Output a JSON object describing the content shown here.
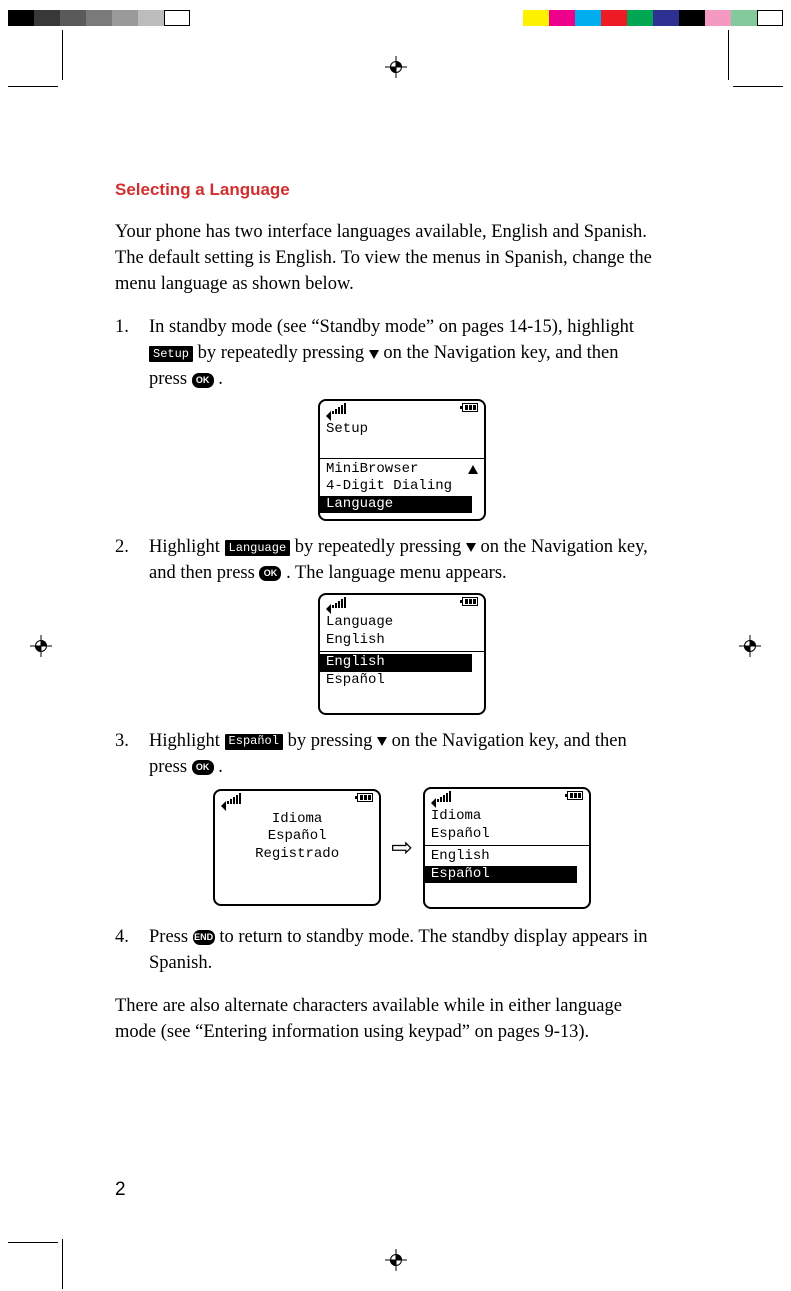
{
  "heading": "Selecting a Language",
  "intro": "Your phone has two interface languages available, English and Spanish. The default setting is English. To view the menus in Spanish, change the menu language as shown below.",
  "steps": {
    "s1": {
      "num": "1.",
      "t1": "In standby mode (see “Standby mode” on pages 14-15), highlight ",
      "chip": "Setup",
      "t2": " by repeatedly pressing ",
      "t3": " on the Navigation key, and then press ",
      "ok": "OK",
      "t4": "."
    },
    "s2": {
      "num": "2.",
      "t1": "Highlight ",
      "chip": "Language",
      "t2": " by repeatedly pressing ",
      "t3": " on the Navigation key, and then press ",
      "ok": "OK",
      "t4": ". The language menu appears."
    },
    "s3": {
      "num": "3.",
      "t1": "Highlight ",
      "chip": "Español",
      "t2": " by pressing ",
      "t3": " on the Navigation key, and then press ",
      "ok": "OK",
      "t4": "."
    },
    "s4": {
      "num": "4.",
      "t1": "Press ",
      "end": "END",
      "t2": " to return to standby mode. The standby display appears in Spanish."
    }
  },
  "screen1": {
    "title": "Setup",
    "row1": "MiniBrowser",
    "row2": "4-Digit Dialing",
    "row3": "Language"
  },
  "screen2": {
    "title": "Language",
    "row1": "English",
    "row2": "English",
    "row3": "Español"
  },
  "screen3a": {
    "l1": "Idioma",
    "l2": "Español",
    "l3": "Registrado"
  },
  "screen3b": {
    "title": "Idioma",
    "row1": "Español",
    "row2": "English",
    "row3": "Español"
  },
  "closing": "There are also alternate characters available while in either language mode (see “Entering information using keypad” on pages 9-13).",
  "page_number": "2",
  "colorbar_left": [
    "#000000",
    "#383838",
    "#5a5a5a",
    "#7a7a7a",
    "#9a9a9a",
    "#bcbcbc",
    "#ffffff"
  ],
  "colorbar_right": [
    "#fff200",
    "#ec008c",
    "#00aeef",
    "#ed1c24",
    "#00a651",
    "#2e3192",
    "#000000",
    "#f49ac1",
    "#82ca9c",
    "#ffffff"
  ]
}
